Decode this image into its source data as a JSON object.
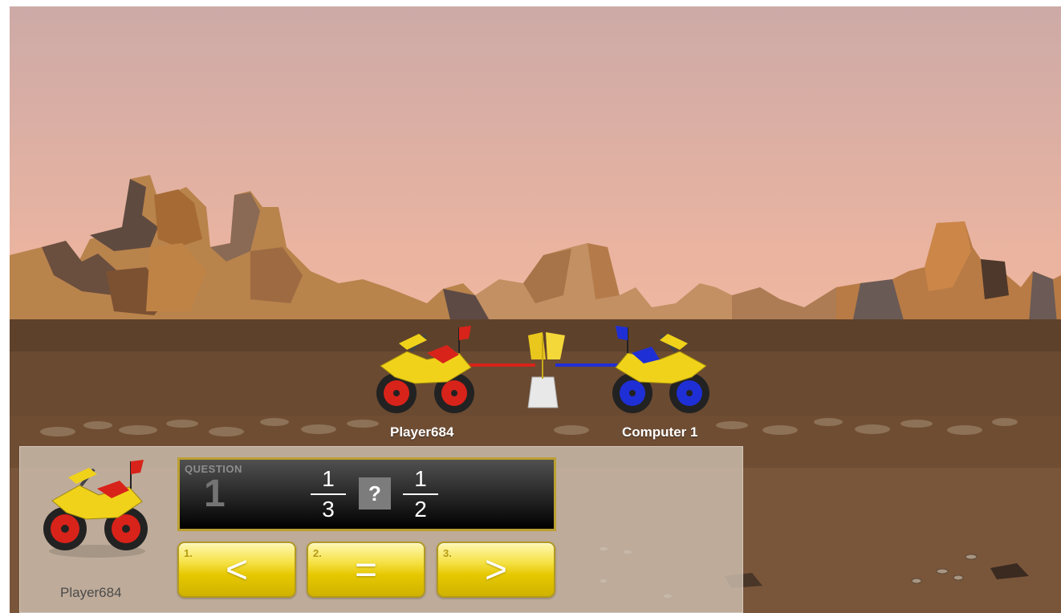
{
  "game": {
    "player_name": "Player684",
    "opponent_name": "Computer 1",
    "player_color": "#d8231a",
    "opponent_color": "#1f2fd6",
    "bike_color": "#f0d21a"
  },
  "panel": {
    "player_name": "Player684",
    "question": {
      "label": "QUESTION",
      "number": "1",
      "left_fraction": {
        "numerator": "1",
        "denominator": "3"
      },
      "operator_placeholder": "?",
      "right_fraction": {
        "numerator": "1",
        "denominator": "2"
      }
    },
    "answers": [
      {
        "index": "1.",
        "symbol": "<"
      },
      {
        "index": "2.",
        "symbol": "="
      },
      {
        "index": "3.",
        "symbol": ">"
      }
    ]
  }
}
